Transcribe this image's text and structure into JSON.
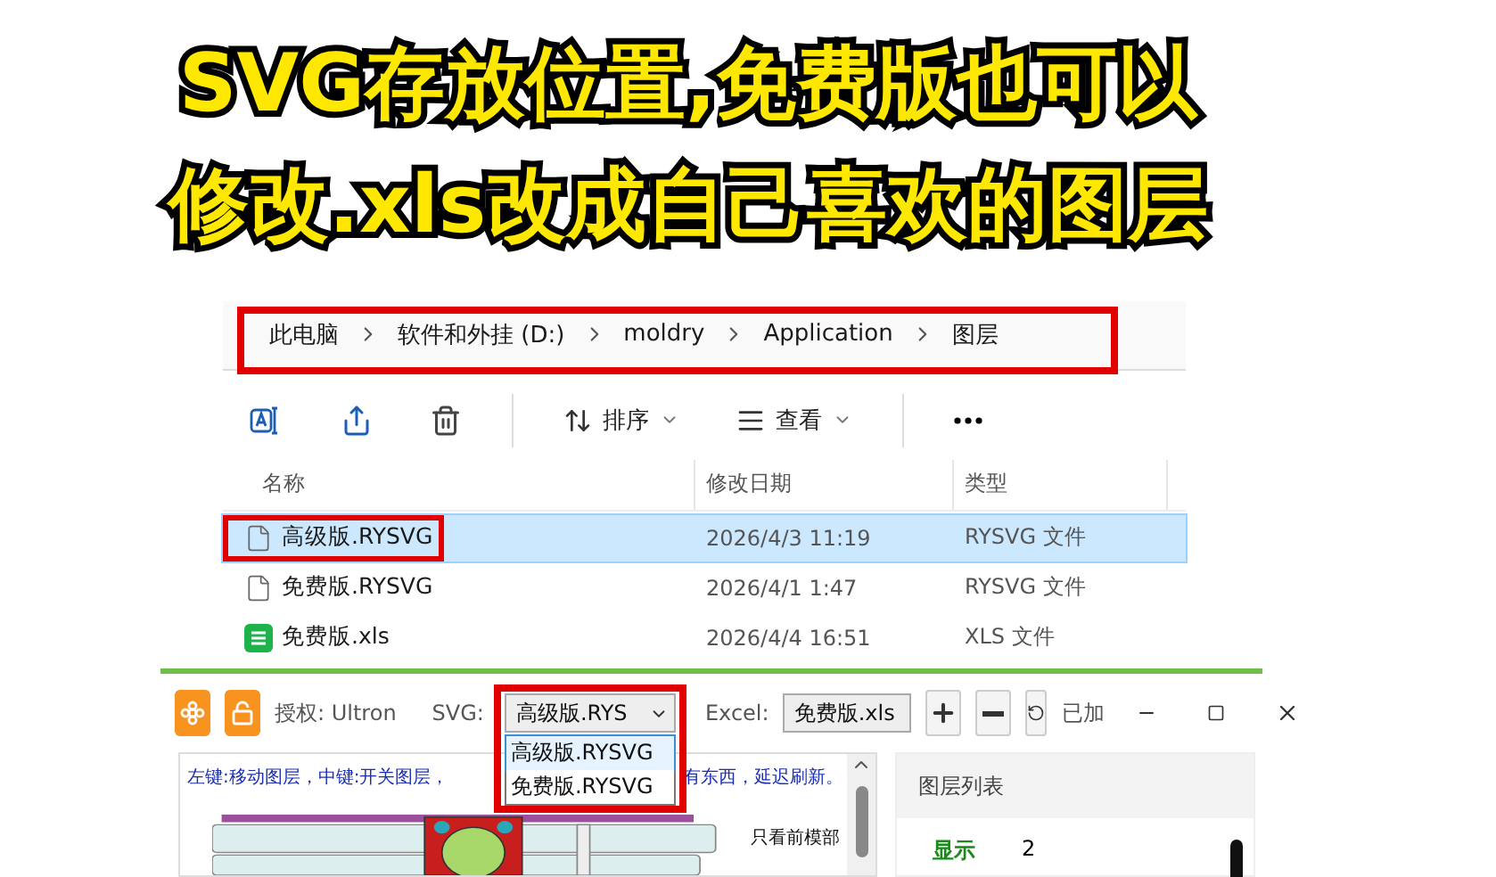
{
  "caption": {
    "lines": [
      "SVG存放位置,免费版也可以",
      "修改.xls改成自己喜欢的图层"
    ]
  },
  "explorer": {
    "breadcrumb": {
      "highlighted": true,
      "items": [
        "此电脑",
        "软件和外挂 (D:)",
        "moldry",
        "Application",
        "图层"
      ]
    },
    "toolbar": [
      {
        "kind": "rename"
      },
      {
        "kind": "share"
      },
      {
        "kind": "delete"
      },
      {
        "kind": "sort",
        "label": "排序"
      },
      {
        "kind": "view",
        "label": "查看"
      },
      {
        "kind": "more"
      }
    ],
    "table": {
      "columns": [
        "名称",
        "修改日期",
        "类型"
      ],
      "rows": [
        {
          "kind": "file",
          "name": "高级版.RYSVG",
          "date": "2026/4/3 11:19",
          "type": "RYSVG 文件",
          "selected": true,
          "highlighted": true
        },
        {
          "kind": "file",
          "name": "免费版.RYSVG",
          "date": "2026/4/1 1:47",
          "type": "RYSVG 文件",
          "selected": false,
          "highlighted": false
        },
        {
          "kind": "sheet",
          "name": "免费版.xls",
          "date": "2026/4/4 16:51",
          "type": "XLS 文件",
          "selected": false,
          "highlighted": false
        }
      ]
    }
  },
  "app": {
    "license": "授权: Ultron",
    "svg_label": "SVG:",
    "svg_value": "高级版.RYS",
    "svg_open": true,
    "svg_highlighted": true,
    "svg_options": [
      {
        "label": "高级版.RYSVG",
        "selected": true
      },
      {
        "label": "免费版.RYSVG",
        "selected": false
      }
    ],
    "excel_label": "Excel:",
    "excel_value": "免费版.xls",
    "status": "已加",
    "canvas": {
      "hint_left": "左键:移动图层，中键:开关图层，",
      "hint_right": "有东西，延迟刷新。",
      "side_label": "只看前模部"
    },
    "layers_panel": {
      "title": "图层列表",
      "rows": [
        {
          "label": "显示",
          "value": "2"
        }
      ]
    }
  }
}
